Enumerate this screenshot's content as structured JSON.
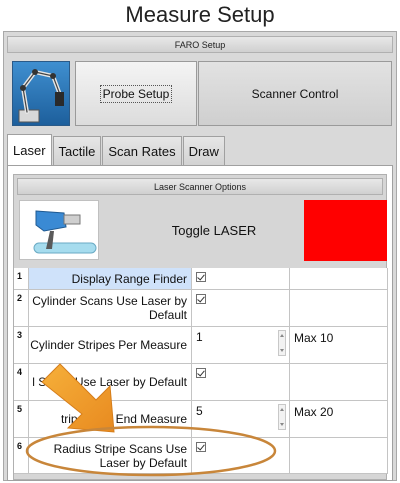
{
  "window": {
    "title": "Measure Setup"
  },
  "faro": {
    "section_title": "FARO Setup",
    "probe_setup_label": "Probe Setup",
    "scanner_control_label": "Scanner Control"
  },
  "tabs": [
    {
      "label": "Laser",
      "active": true
    },
    {
      "label": "Tactile",
      "active": false
    },
    {
      "label": "Scan Rates",
      "active": false
    },
    {
      "label": "Draw",
      "active": false
    }
  ],
  "laser": {
    "section_title": "Laser Scanner Options",
    "toggle_label": "Toggle LASER",
    "indicator_color": "#ff0000"
  },
  "options": [
    {
      "num": "1",
      "label": "Display Range Finder",
      "type": "check",
      "value": "",
      "max": "",
      "checked": true
    },
    {
      "num": "2",
      "label": "Cylinder Scans Use Laser by Default",
      "type": "check",
      "value": "",
      "max": "",
      "checked": true
    },
    {
      "num": "3",
      "label": "Cylinder Stripes Per Measure",
      "type": "number",
      "value": "1",
      "max": "Max 10"
    },
    {
      "num": "4",
      "label": "l Scans Use Laser by Default",
      "type": "check",
      "value": "",
      "max": "",
      "checked": true
    },
    {
      "num": "5",
      "label": "tripes Per End Measure",
      "type": "number",
      "value": "5",
      "max": "Max 20"
    },
    {
      "num": "6",
      "label": "Radius Stripe Scans Use Laser by Default",
      "type": "check",
      "value": "",
      "max": "",
      "checked": true
    }
  ],
  "annotation": {
    "arrow_color": "#f0a030",
    "ellipse_color": "#c8863a"
  },
  "icons": {
    "robot": "faro-arm-icon",
    "laser_scanner": "laser-scanner-icon",
    "checkbox": "checkbox-checked-icon",
    "spinner": "spinner-icon"
  }
}
